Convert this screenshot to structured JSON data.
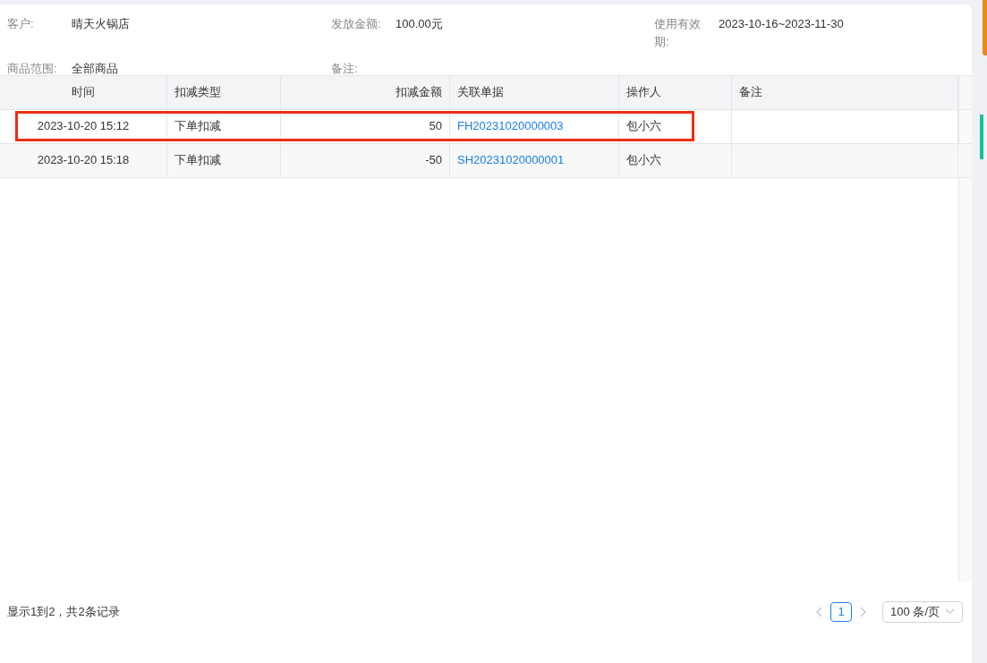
{
  "info": [
    {
      "label": "客户:",
      "value": "晴天火锅店"
    },
    {
      "label": "发放金额:",
      "value": "100.00元"
    },
    {
      "label": "使用有效期:",
      "value": "2023-10-16~2023-11-30"
    },
    {
      "label": "商品范围:",
      "value": "全部商品"
    },
    {
      "label": "备注:"
    }
  ],
  "table": {
    "columns": [
      {
        "label": "时间"
      },
      {
        "label": "扣减类型"
      },
      {
        "label": "扣减金额"
      },
      {
        "label": "关联单据"
      },
      {
        "label": "操作人"
      },
      {
        "label": "备注"
      }
    ],
    "rows": [
      {
        "highlighted": true,
        "cells": [
          "2023-10-20 15:12",
          "下单扣减",
          "50",
          "FH20231020000003",
          "包小六",
          ""
        ]
      },
      {
        "highlighted": false,
        "cells": [
          "2023-10-20 15:18",
          "下单扣减",
          "-50",
          "SH20231020000001",
          "包小六",
          ""
        ]
      }
    ]
  },
  "footer": {
    "summary": "显示1到2，共2条记录",
    "pages": [
      {
        "label": "1",
        "selected": true
      }
    ],
    "page_size": "100 条/页"
  }
}
